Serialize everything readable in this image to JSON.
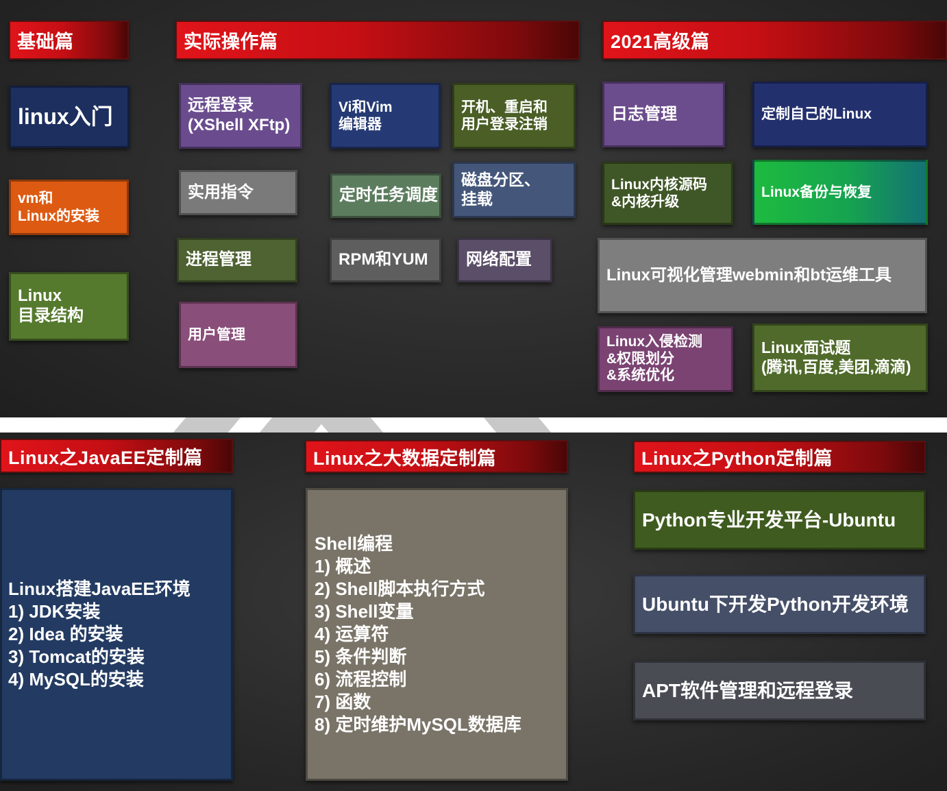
{
  "top": {
    "headers": {
      "basic": "基础篇",
      "practical": "实际操作篇",
      "advanced": "2021高级篇"
    },
    "boxes": {
      "linux_intro": "linux入门",
      "vm_install": "vm和\nLinux的安装",
      "dir_structure": "Linux\n目录结构",
      "remote_login": "远程登录\n(XShell XFtp)",
      "vi_vim": "Vi和Vim\n编辑器",
      "boot_login": "开机、重启和\n用户登录注销",
      "useful_cmds": "实用指令",
      "cron": "定时任务调度",
      "disk": "磁盘分区、\n挂载",
      "process": "进程管理",
      "rpm_yum": "RPM和YUM",
      "network": "网络配置",
      "user_mgmt": "用户管理",
      "log_mgmt": "日志管理",
      "custom_linux": "定制自己的Linux",
      "kernel": "Linux内核源码\n&内核升级",
      "backup": "Linux备份与恢复",
      "webmin": "Linux可视化管理webmin和bt运维工具",
      "intrusion": "Linux入侵检测\n&权限划分\n&系统优化",
      "interview": "Linux面试题\n(腾讯,百度,美团,滴滴)"
    }
  },
  "bottom": {
    "headers": {
      "javaee": "Linux之JavaEE定制篇",
      "bigdata": "Linux之大数据定制篇",
      "python": "Linux之Python定制篇"
    },
    "javaee_list": [
      "Linux搭建JavaEE环境",
      "1)  JDK安装",
      "2)  Idea 的安装",
      "3)  Tomcat的安装",
      "4)  MySQL的安装"
    ],
    "bigdata_list": [
      "Shell编程",
      "1)  概述",
      "2)  Shell脚本执行方式",
      "3)  Shell变量",
      "4)  运算符",
      "5)  条件判断",
      "6)  流程控制",
      "7)  函数",
      "8)  定时维护MySQL数据库"
    ],
    "python_boxes": {
      "ubuntu": "Python专业开发平台-Ubuntu",
      "dev_env": "Ubuntu下开发Python开发环境",
      "apt": "APT软件管理和远程登录"
    }
  }
}
